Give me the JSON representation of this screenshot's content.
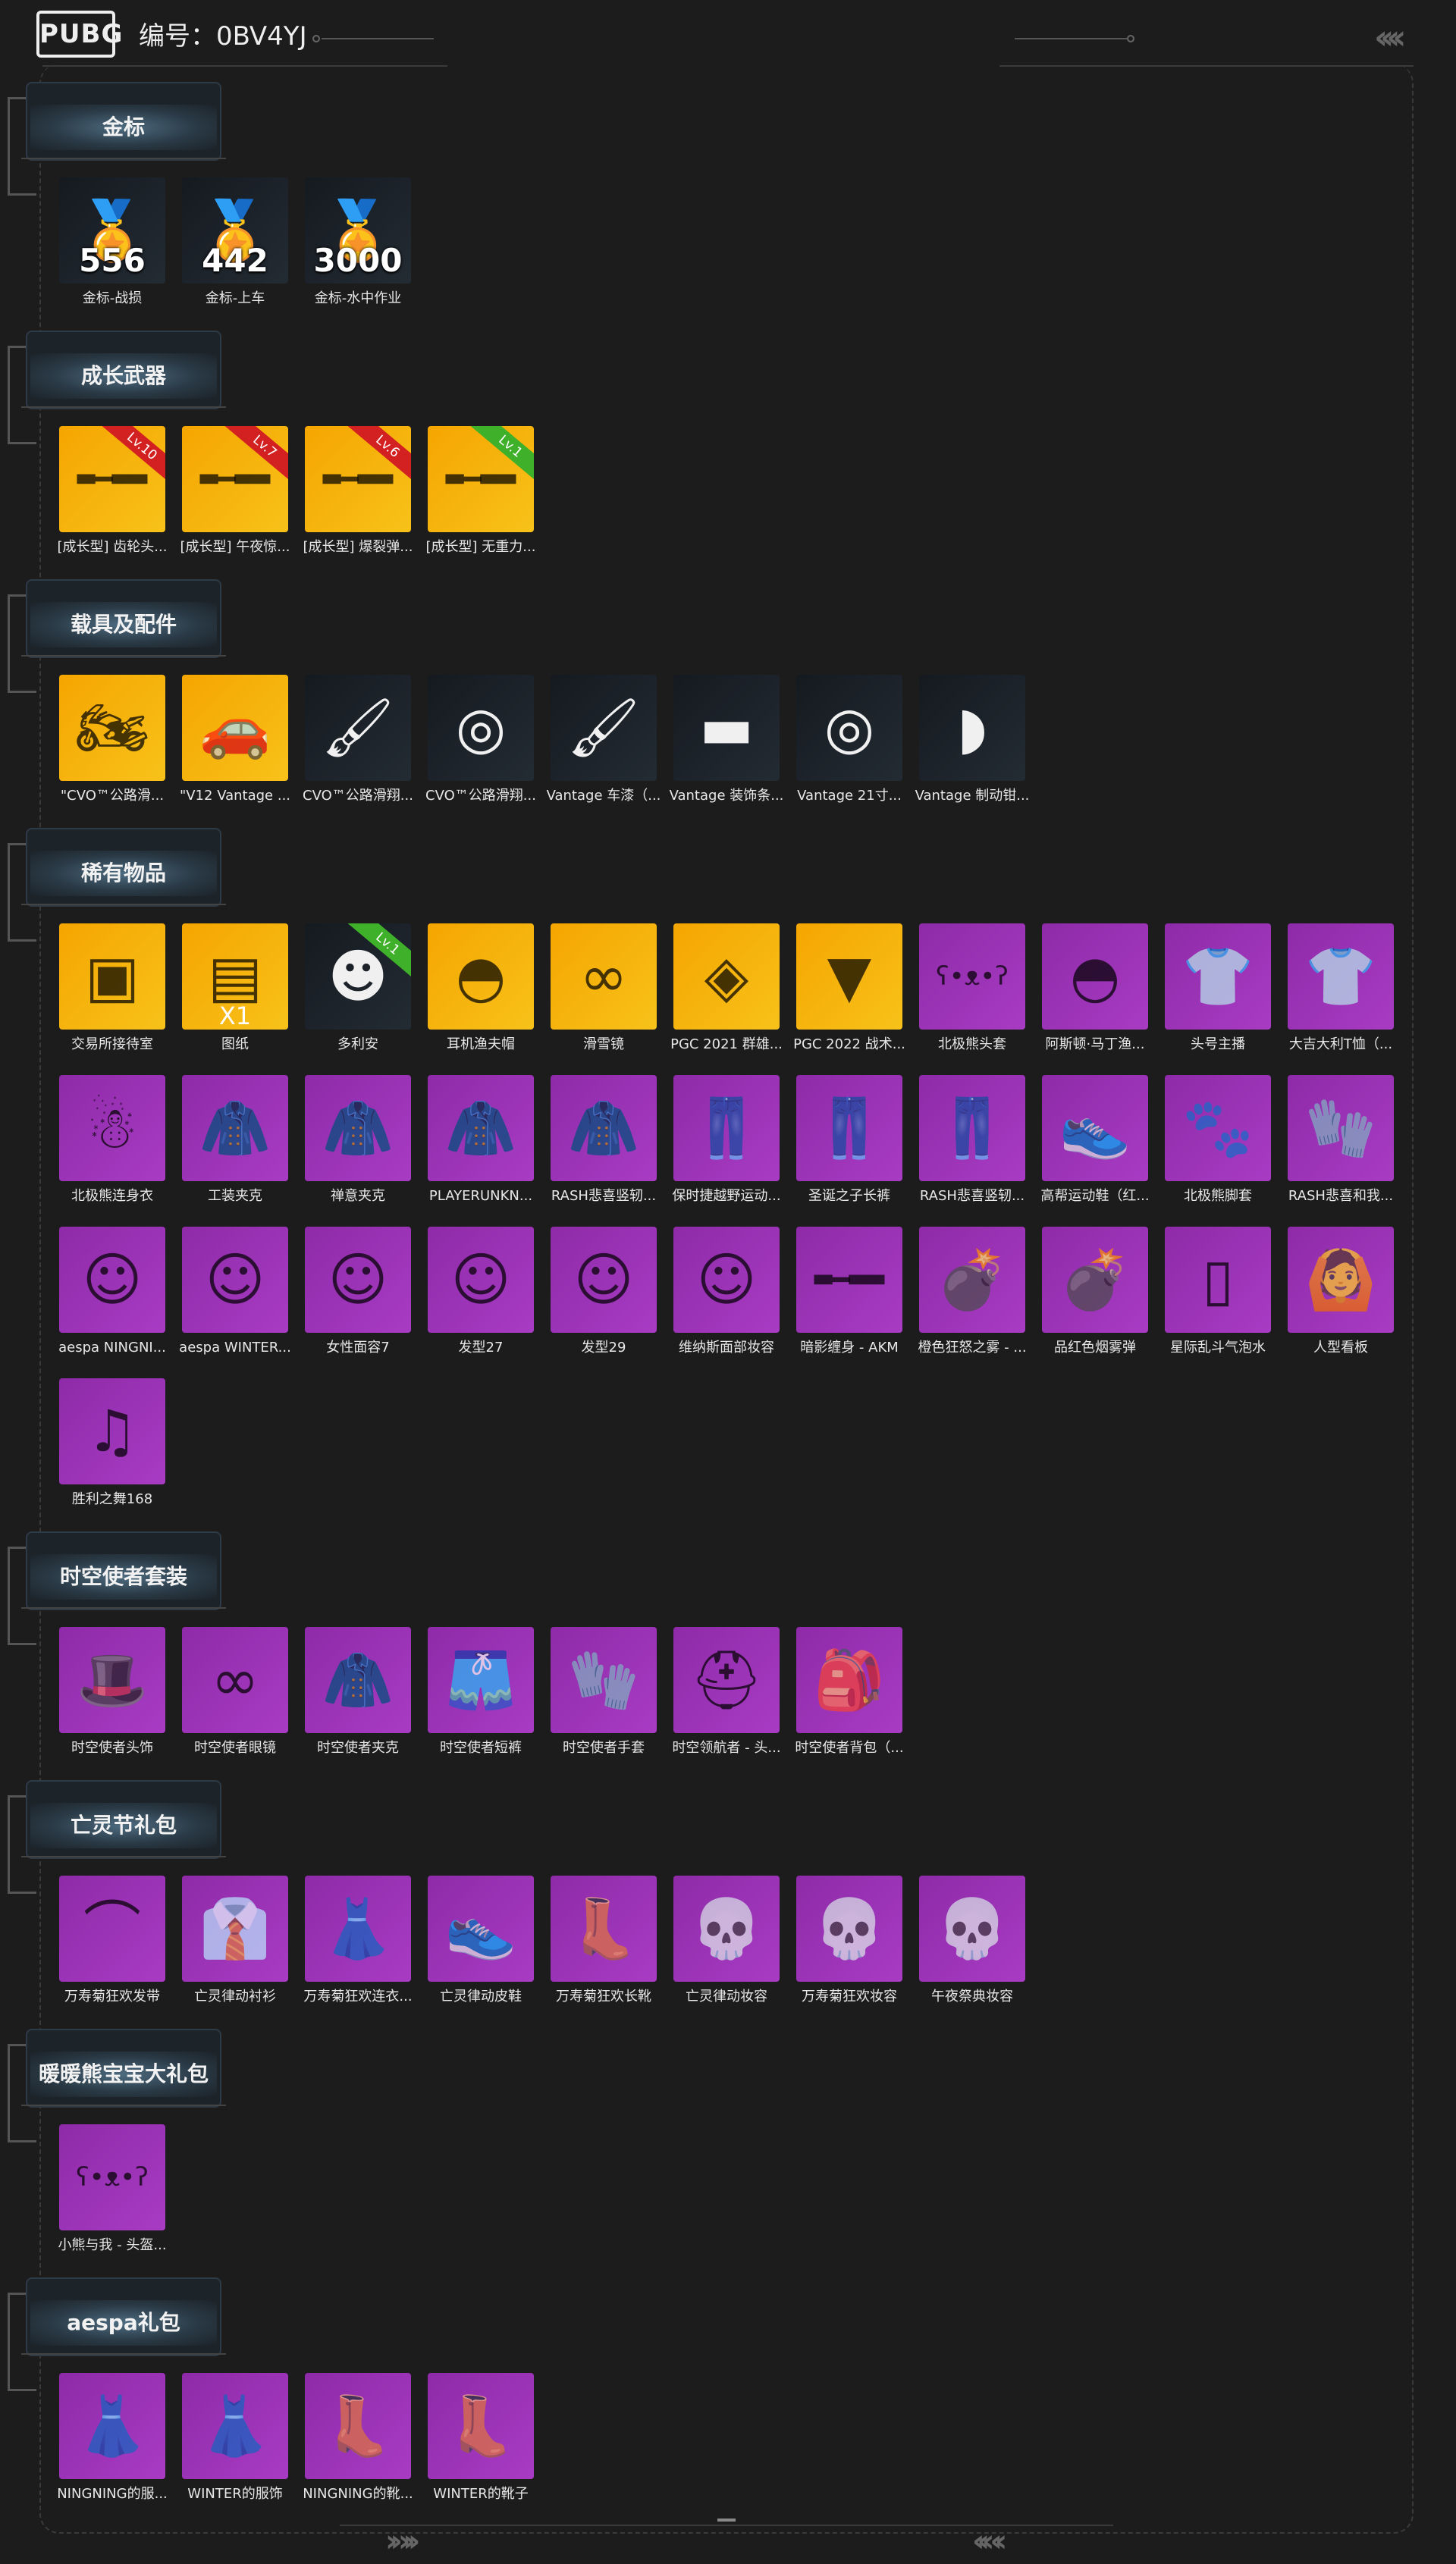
{
  "header": {
    "logo_text": "PUBG",
    "serial": "编号：0BV4YJ"
  },
  "sections": [
    {
      "title": "金标",
      "items": [
        {
          "name": "金标-战损",
          "count": "556",
          "rarity": "dark",
          "icon": "gold-medal-icon"
        },
        {
          "name": "金标-上车",
          "count": "442",
          "rarity": "dark",
          "icon": "gold-medal-icon"
        },
        {
          "name": "金标-水中作业",
          "count": "3000",
          "rarity": "dark",
          "icon": "gold-medal-icon"
        }
      ]
    },
    {
      "title": "成长武器",
      "items": [
        {
          "name": "[成长型] 齿轮头...",
          "level": "Lv.10",
          "level_color": "red",
          "rarity": "gold",
          "icon": "rifle-icon"
        },
        {
          "name": "[成长型] 午夜惊...",
          "level": "Lv.7",
          "level_color": "red",
          "rarity": "gold",
          "icon": "rifle-icon"
        },
        {
          "name": "[成长型] 爆裂弹...",
          "level": "Lv.6",
          "level_color": "red",
          "rarity": "gold",
          "icon": "rifle-icon"
        },
        {
          "name": "[成长型] 无重力...",
          "level": "Lv.1",
          "level_color": "green",
          "rarity": "gold",
          "icon": "smg-icon"
        }
      ]
    },
    {
      "title": "载具及配件",
      "items": [
        {
          "name": "\"CVO™公路滑...",
          "rarity": "gold",
          "icon": "motorcycle-icon"
        },
        {
          "name": "\"V12 Vantage ...",
          "rarity": "gold",
          "icon": "car-icon"
        },
        {
          "name": "CVO™公路滑翔...",
          "rarity": "dark",
          "icon": "paint-gun-icon"
        },
        {
          "name": "CVO™公路滑翔...",
          "rarity": "dark",
          "icon": "wheel-icon"
        },
        {
          "name": "Vantage 车漆（...",
          "rarity": "dark",
          "icon": "paint-gun-icon"
        },
        {
          "name": "Vantage 装饰条...",
          "rarity": "dark",
          "icon": "trim-icon"
        },
        {
          "name": "Vantage 21寸...",
          "rarity": "dark",
          "icon": "wheel-icon"
        },
        {
          "name": "Vantage 制动钳...",
          "rarity": "dark",
          "icon": "brake-caliper-icon"
        }
      ]
    },
    {
      "title": "稀有物品",
      "items": [
        {
          "name": "交易所接待室",
          "rarity": "gold",
          "icon": "room-icon"
        },
        {
          "name": "图纸",
          "count": "X1",
          "rarity": "gold",
          "icon": "blueprint-icon"
        },
        {
          "name": "多利安",
          "level": "Lv.1",
          "level_color": "green",
          "rarity": "dark",
          "icon": "character-icon"
        },
        {
          "name": "耳机渔夫帽",
          "rarity": "gold",
          "icon": "bucket-hat-icon"
        },
        {
          "name": "滑雪镜",
          "rarity": "gold",
          "icon": "goggles-icon"
        },
        {
          "name": "PGC 2021 群雄...",
          "rarity": "gold",
          "icon": "mask-icon"
        },
        {
          "name": "PGC 2022 战术...",
          "rarity": "gold",
          "icon": "vest-icon"
        },
        {
          "name": "北极熊头套",
          "rarity": "purple",
          "icon": "bear-head-icon"
        },
        {
          "name": "阿斯顿·马丁渔...",
          "rarity": "purple",
          "icon": "bucket-hat-icon"
        },
        {
          "name": "头号主播",
          "rarity": "purple",
          "icon": "tshirt-icon"
        },
        {
          "name": "大吉大利T恤（...",
          "rarity": "purple",
          "icon": "tshirt-icon"
        },
        {
          "name": "北极熊连身衣",
          "rarity": "purple",
          "icon": "jumpsuit-icon"
        },
        {
          "name": "工装夹克",
          "rarity": "purple",
          "icon": "jacket-icon"
        },
        {
          "name": "禅意夹克",
          "rarity": "purple",
          "icon": "hoodie-icon"
        },
        {
          "name": "PLAYERUNKN...",
          "rarity": "purple",
          "icon": "coat-icon"
        },
        {
          "name": "RASH悲喜竖轫...",
          "rarity": "purple",
          "icon": "hoodie-icon"
        },
        {
          "name": "保时捷越野运动...",
          "rarity": "purple",
          "icon": "pants-icon"
        },
        {
          "name": "圣诞之子长裤",
          "rarity": "purple",
          "icon": "pants-icon"
        },
        {
          "name": "RASH悲喜竖轫...",
          "rarity": "purple",
          "icon": "pants-icon"
        },
        {
          "name": "高帮运动鞋（红...",
          "rarity": "purple",
          "icon": "shoes-icon"
        },
        {
          "name": "北极熊脚套",
          "rarity": "purple",
          "icon": "paw-icon"
        },
        {
          "name": "RASH悲喜和我...",
          "rarity": "purple",
          "icon": "gloves-icon"
        },
        {
          "name": "aespa NINGNI...",
          "rarity": "purple",
          "icon": "face-icon"
        },
        {
          "name": "aespa WINTER...",
          "rarity": "purple",
          "icon": "face-icon"
        },
        {
          "name": "女性面容7",
          "rarity": "purple",
          "icon": "face-icon"
        },
        {
          "name": "发型27",
          "rarity": "purple",
          "icon": "hairstyle-icon"
        },
        {
          "name": "发型29",
          "rarity": "purple",
          "icon": "hairstyle-icon"
        },
        {
          "name": "维纳斯面部妆容",
          "rarity": "purple",
          "icon": "face-icon"
        },
        {
          "name": "暗影缠身 - AKM",
          "rarity": "purple",
          "icon": "rifle-icon"
        },
        {
          "name": "橙色狂怒之雾 - ...",
          "rarity": "purple",
          "icon": "smoke-grenade-icon"
        },
        {
          "name": "品红色烟雾弹",
          "rarity": "purple",
          "icon": "smoke-grenade-icon"
        },
        {
          "name": "星际乱斗气泡水",
          "rarity": "purple",
          "icon": "can-icon"
        },
        {
          "name": "人型看板",
          "rarity": "purple",
          "icon": "figure-icon"
        },
        {
          "name": "胜利之舞168",
          "rarity": "purple",
          "icon": "dance-icon"
        }
      ]
    },
    {
      "title": "时空使者套装",
      "items": [
        {
          "name": "时空使者头饰",
          "rarity": "purple",
          "icon": "headwear-icon"
        },
        {
          "name": "时空使者眼镜",
          "rarity": "purple",
          "icon": "goggles-icon"
        },
        {
          "name": "时空使者夹克",
          "rarity": "purple",
          "icon": "jacket-icon"
        },
        {
          "name": "时空使者短裤",
          "rarity": "purple",
          "icon": "shorts-icon"
        },
        {
          "name": "时空使者手套",
          "rarity": "purple",
          "icon": "gloves-icon"
        },
        {
          "name": "时空领航者 - 头...",
          "rarity": "purple",
          "icon": "helmet-icon"
        },
        {
          "name": "时空使者背包（...",
          "rarity": "purple",
          "icon": "backpack-icon"
        }
      ]
    },
    {
      "title": "亡灵节礼包",
      "items": [
        {
          "name": "万寿菊狂欢发带",
          "rarity": "purple",
          "icon": "headband-icon"
        },
        {
          "name": "亡灵律动衬衫",
          "rarity": "purple",
          "icon": "shirt-icon"
        },
        {
          "name": "万寿菊狂欢连衣...",
          "rarity": "purple",
          "icon": "dress-icon"
        },
        {
          "name": "亡灵律动皮鞋",
          "rarity": "purple",
          "icon": "shoes-icon"
        },
        {
          "name": "万寿菊狂欢长靴",
          "rarity": "purple",
          "icon": "boots-icon"
        },
        {
          "name": "亡灵律动妆容",
          "rarity": "purple",
          "icon": "skull-icon"
        },
        {
          "name": "万寿菊狂欢妆容",
          "rarity": "purple",
          "icon": "skull-icon"
        },
        {
          "name": "午夜祭典妆容",
          "rarity": "purple",
          "icon": "skull-icon"
        }
      ]
    },
    {
      "title": "暖暖熊宝宝大礼包",
      "items": [
        {
          "name": "小熊与我 - 头盔...",
          "rarity": "purple",
          "icon": "bear-helmet-icon"
        }
      ]
    },
    {
      "title": "aespa礼包",
      "items": [
        {
          "name": "NINGNING的服...",
          "rarity": "purple",
          "icon": "outfit-icon"
        },
        {
          "name": "WINTER的服饰",
          "rarity": "purple",
          "icon": "outfit-icon"
        },
        {
          "name": "NINGNING的靴...",
          "rarity": "purple",
          "icon": "boots-icon"
        },
        {
          "name": "WINTER的靴子",
          "rarity": "purple",
          "icon": "boots-icon"
        }
      ]
    }
  ],
  "colors": {
    "background": "#1c1c1c",
    "gold_tile": "#f7b80e",
    "purple_tile": "#9b33b8",
    "dark_tile": "#1b2229",
    "ribbon_red": "#d32020",
    "ribbon_green": "#3fb02a"
  }
}
